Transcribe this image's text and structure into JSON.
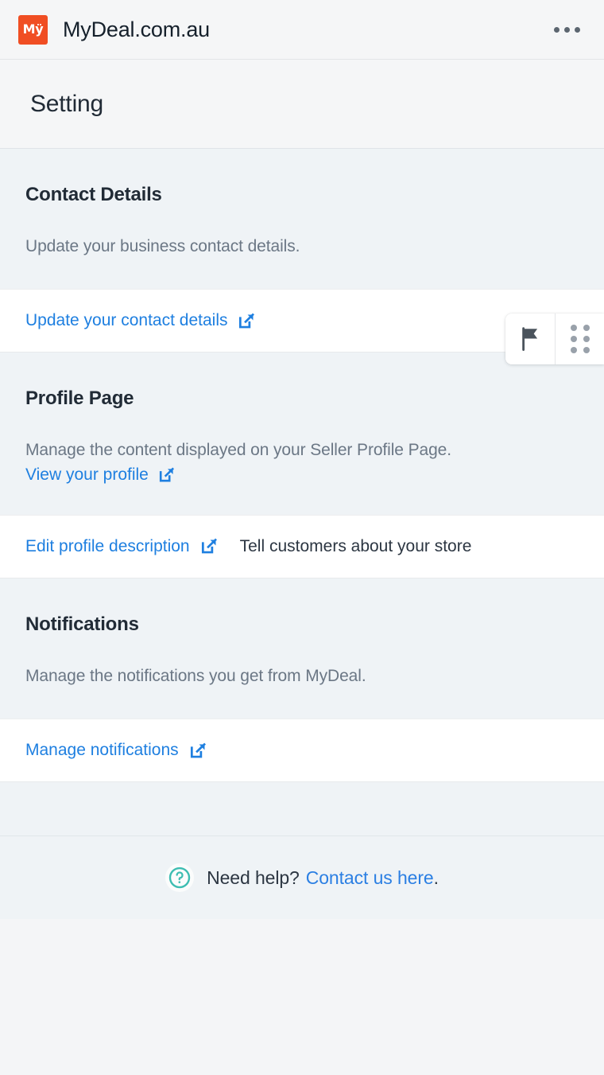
{
  "appbar": {
    "logo_text": "Mÿ",
    "logo_icon": "mydeal-logo-icon",
    "title": "MyDeal.com.au",
    "overflow_icon": "more-horizontal-icon",
    "brand_color": "#f04e23"
  },
  "page": {
    "title": "Setting"
  },
  "float_widget": {
    "flag_icon": "flag-icon",
    "grid_icon": "grid-dots-icon"
  },
  "sections": [
    {
      "title": "Contact Details",
      "description": "Update your business contact details.",
      "link_label": "Update your contact details",
      "link_icon": "external-link-icon"
    },
    {
      "title": "Profile Page",
      "description": "Manage the content displayed on your Seller Profile Page.",
      "inline_link_label": "View your profile",
      "inline_link_icon": "external-link-icon",
      "link_label": "Edit profile description",
      "link_icon": "external-link-icon",
      "row_note": "Tell customers about your store"
    },
    {
      "title": "Notifications",
      "description": "Manage the notifications you get from MyDeal.",
      "link_label": "Manage notifications",
      "link_icon": "external-link-icon"
    }
  ],
  "footer": {
    "help_icon": "question-mark-circle-icon",
    "help_icon_color": "#3dbdb2",
    "text": "Need help?",
    "link_label": "Contact us here",
    "period": ".",
    "link_color": "#2b7fe3"
  }
}
